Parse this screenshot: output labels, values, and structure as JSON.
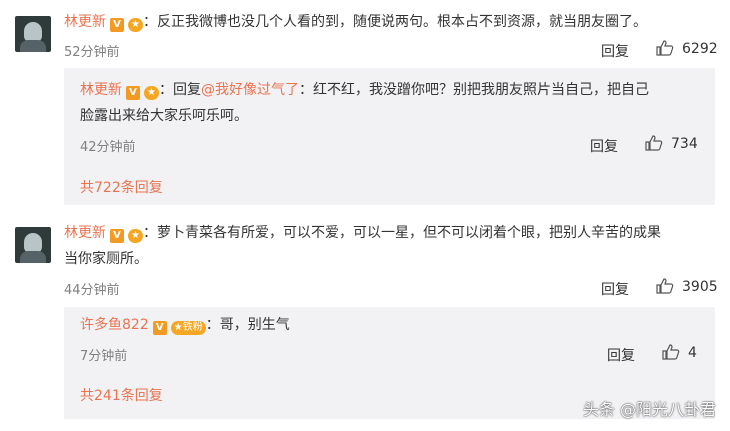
{
  "comments": [
    {
      "author": "林更新",
      "text": "：反正我微博也没几个人看的到，随便说两句。根本占不到资源，就当朋友圈了。",
      "time": "52分钟前",
      "reply_label": "回复",
      "likes": "6292",
      "sub_reply": {
        "author": "林更新",
        "prefix": "：回复",
        "mention": "@我好像过气了",
        "text_line1": "：红不红，我没蹭你吧？别把我朋友照片当自己，把自己",
        "text_line2": "脸露出来给大家乐呵乐呵。",
        "time": "42分钟前",
        "reply_label": "回复",
        "likes": "734"
      },
      "more": "共722条回复"
    },
    {
      "author": "林更新",
      "text_line1": "：萝卜青菜各有所爱，可以不爱，可以一星，但不可以闭着个眼，把别人辛苦的成果",
      "text_line2": "当你家厕所。",
      "time": "44分钟前",
      "reply_label": "回复",
      "likes": "3905",
      "sub_reply": {
        "author": "许多鱼822",
        "fan_badge": "铁粉",
        "text": "：哥，别生气",
        "time": "7分钟前",
        "reply_label": "回复",
        "likes": "4"
      },
      "more": "共241条回复"
    }
  ],
  "badges": {
    "verified": "V"
  },
  "watermark": "头条 @阳光八卦君",
  "colors": {
    "name": "#eb7350",
    "sub_bg": "#f2f2f5",
    "badge": "#f29a22"
  }
}
